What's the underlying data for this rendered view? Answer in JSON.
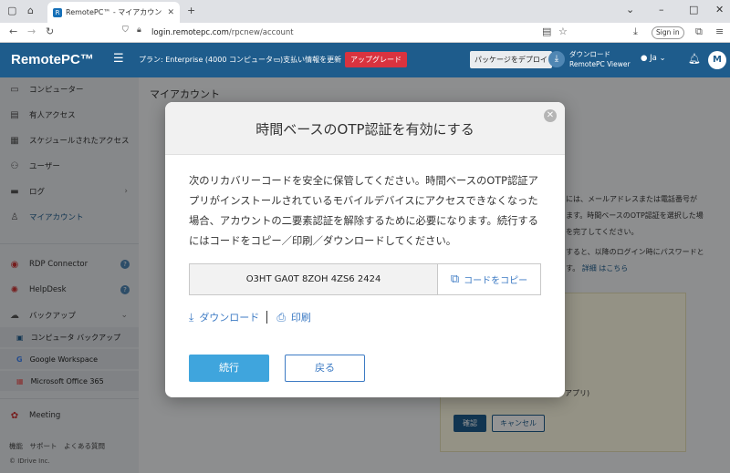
{
  "browser": {
    "tab_title": "RemotePC™ - マイアカウント№",
    "url_domain": "login.remotepc.com",
    "url_path": "/rpcnew/account",
    "signin_label": "Sign in"
  },
  "header": {
    "logo": "RemotePC™",
    "plan": "プラン: Enterprise (4000 コンピューター)",
    "billing": "支払い情報を更新",
    "upgrade": "アップグレード",
    "deploy": "パッケージをデプロイ",
    "download_line1": "ダウンロード",
    "download_line2": "RemotePC Viewer",
    "language": "Ja",
    "avatar": "M"
  },
  "sidebar": {
    "items": [
      {
        "label": "コンピューター",
        "icon": "monitor-icon"
      },
      {
        "label": "有人アクセス",
        "icon": "screen-icon"
      },
      {
        "label": "スケジュールされたアクセス",
        "icon": "calendar-icon"
      },
      {
        "label": "ユーザー",
        "icon": "users-icon"
      },
      {
        "label": "ログ",
        "icon": "log-icon"
      },
      {
        "label": "マイアカウント",
        "icon": "person-icon"
      }
    ],
    "rdp": "RDP Connector",
    "helpdesk": "HelpDesk",
    "backup": "バックアップ",
    "backup_items": [
      "コンピュータ バックアップ",
      "Google Workspace",
      "Microsoft Office 365"
    ],
    "meeting": "Meeting",
    "footer": "機能　サポート　よくある質問",
    "copyright": "© IDrive Inc."
  },
  "main": {
    "title": "マイアカウント",
    "text1": "には、メールアドレスまたは電話番号が",
    "text2": "ます。時間ベースのOTP認証を選択した場",
    "text3": "を完了してください。",
    "text4": "すると、以降のログイン時にパスワードと",
    "text5": "す。",
    "link": "詳細 はこちら",
    "text6": "アプリ)",
    "confirm": "確認",
    "cancel": "キャンセル"
  },
  "modal": {
    "title": "時間ベースのOTP認証を有効にする",
    "description": "次のリカバリーコードを安全に保管してください。時間ベースのOTP認証アプリがインストールされているモバイルデバイスにアクセスできなくなった場合、アカウントの二要素認証を解除するために必要になります。続行するにはコードをコピー／印刷／ダウンロードしてください。",
    "code": "O3HT GA0T 8ZOH 4ZS6 2424",
    "copy_label": "コードをコピー",
    "download_label": "ダウンロード",
    "print_label": "印刷",
    "continue_label": "続行",
    "back_label": "戻る"
  }
}
